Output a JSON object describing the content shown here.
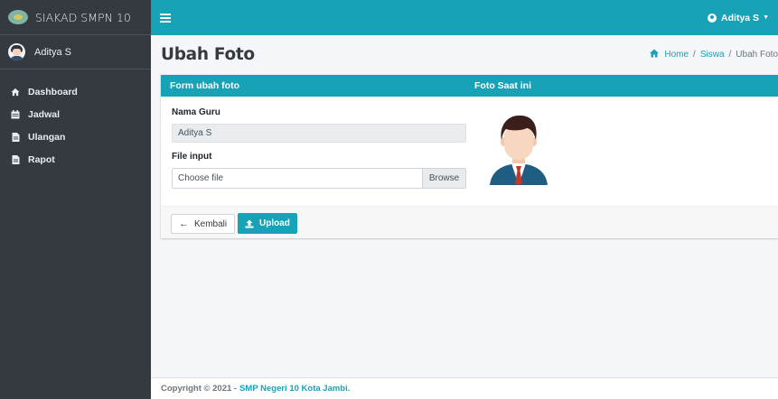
{
  "sidebar": {
    "brand": "SIAKAD SMPN 10",
    "user": "Aditya S",
    "items": [
      {
        "label": "Dashboard",
        "icon": "home-icon"
      },
      {
        "label": "Jadwal",
        "icon": "calendar-icon"
      },
      {
        "label": "Ulangan",
        "icon": "file-icon"
      },
      {
        "label": "Rapot",
        "icon": "file-icon"
      }
    ]
  },
  "topbar": {
    "user": "Aditya S"
  },
  "header": {
    "title": "Ubah Foto",
    "breadcrumb": {
      "home": "Home",
      "section": "Siswa",
      "current": "Ubah Foto"
    }
  },
  "card": {
    "form_title": "Form ubah foto",
    "photo_title": "Foto Saat ini",
    "name_label": "Nama Guru",
    "name_value": "Aditya S",
    "file_label": "File input",
    "file_placeholder": "Choose file",
    "browse_label": "Browse",
    "back_label": "Kembali",
    "upload_label": "Upload"
  },
  "footer": {
    "text": "Copyright © 2021 -",
    "link": "SMP Negeri 10 Kota Jambi."
  },
  "colors": {
    "accent": "#17a2b8",
    "sidebar": "#343a40"
  }
}
